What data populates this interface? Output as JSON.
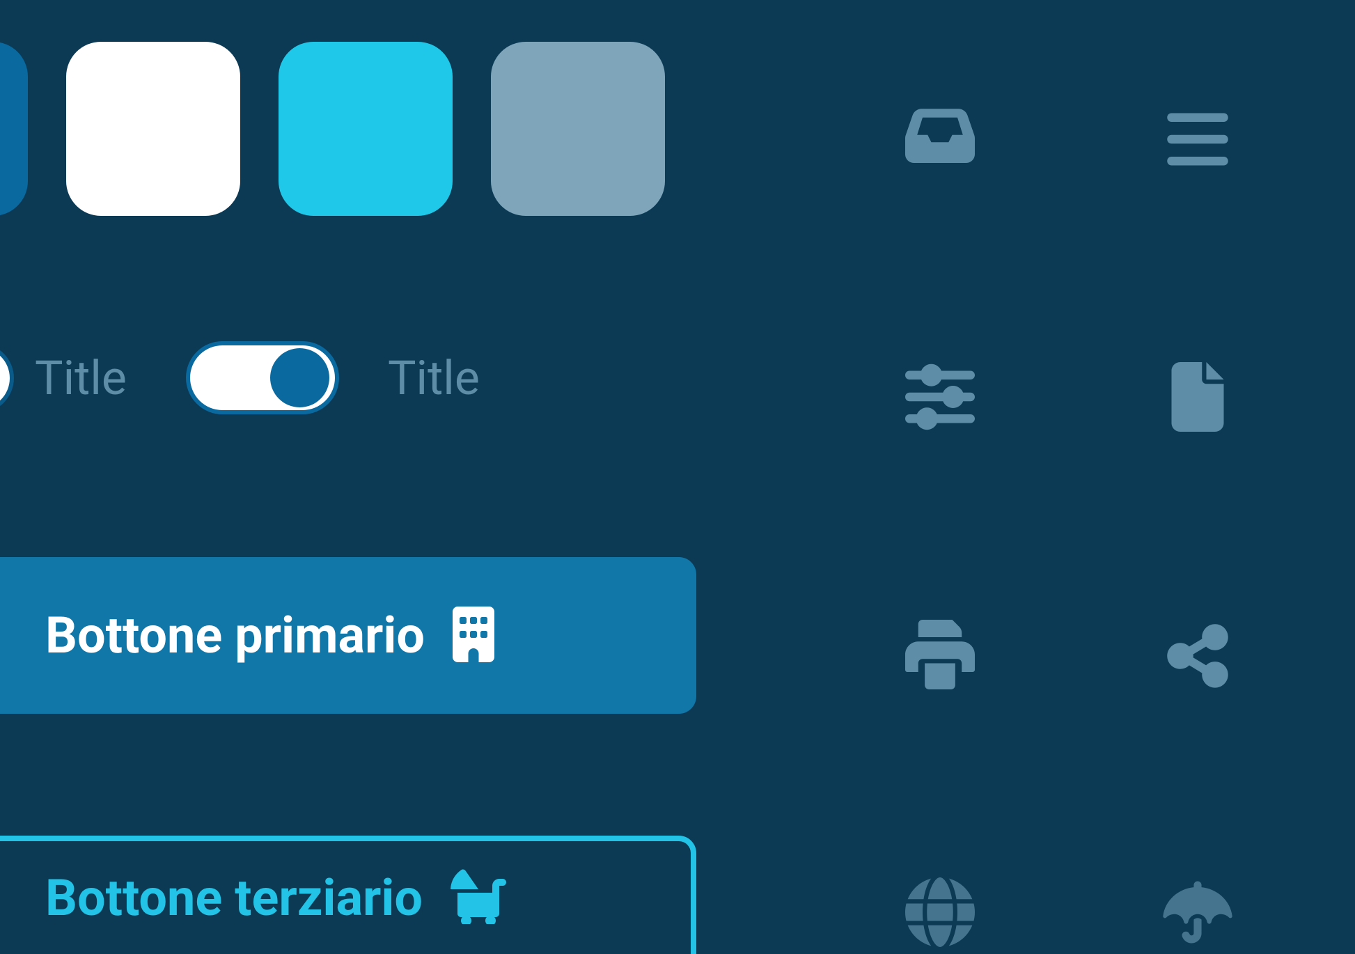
{
  "swatches": {
    "edge_color": "#0a6aa0",
    "white_color": "#ffffff",
    "cyan_color": "#1fc8e8",
    "muted_color": "#7fa5bb"
  },
  "toggles": {
    "label1": "Title",
    "label2": "Title"
  },
  "buttons": {
    "primary_label": "Bottone primario",
    "tertiary_label": "Bottone terziario"
  },
  "icons": {
    "inbox": "inbox-icon",
    "menu": "menu-icon",
    "sliders": "sliders-icon",
    "file": "file-icon",
    "print": "print-icon",
    "share": "share-icon",
    "globe": "globe-icon",
    "umbrella": "umbrella-icon",
    "building": "building-icon",
    "stroller": "stroller-icon"
  },
  "colors": {
    "background": "#0c3a55",
    "primary_button": "#1176a8",
    "tertiary_accent": "#22c3e6",
    "icon_muted": "#5e8da8"
  }
}
